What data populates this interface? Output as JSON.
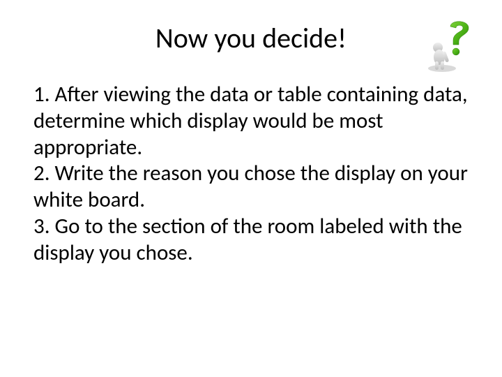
{
  "title": "Now you decide!",
  "icon_name": "question-mark-figure-icon",
  "items": {
    "item1": "1. After viewing the data or table containing data, determine which display would be most appropriate.",
    "item2": "2. Write the reason you chose the display on your white board.",
    "item3": "3. Go to the section of the room labeled with the display you chose."
  }
}
